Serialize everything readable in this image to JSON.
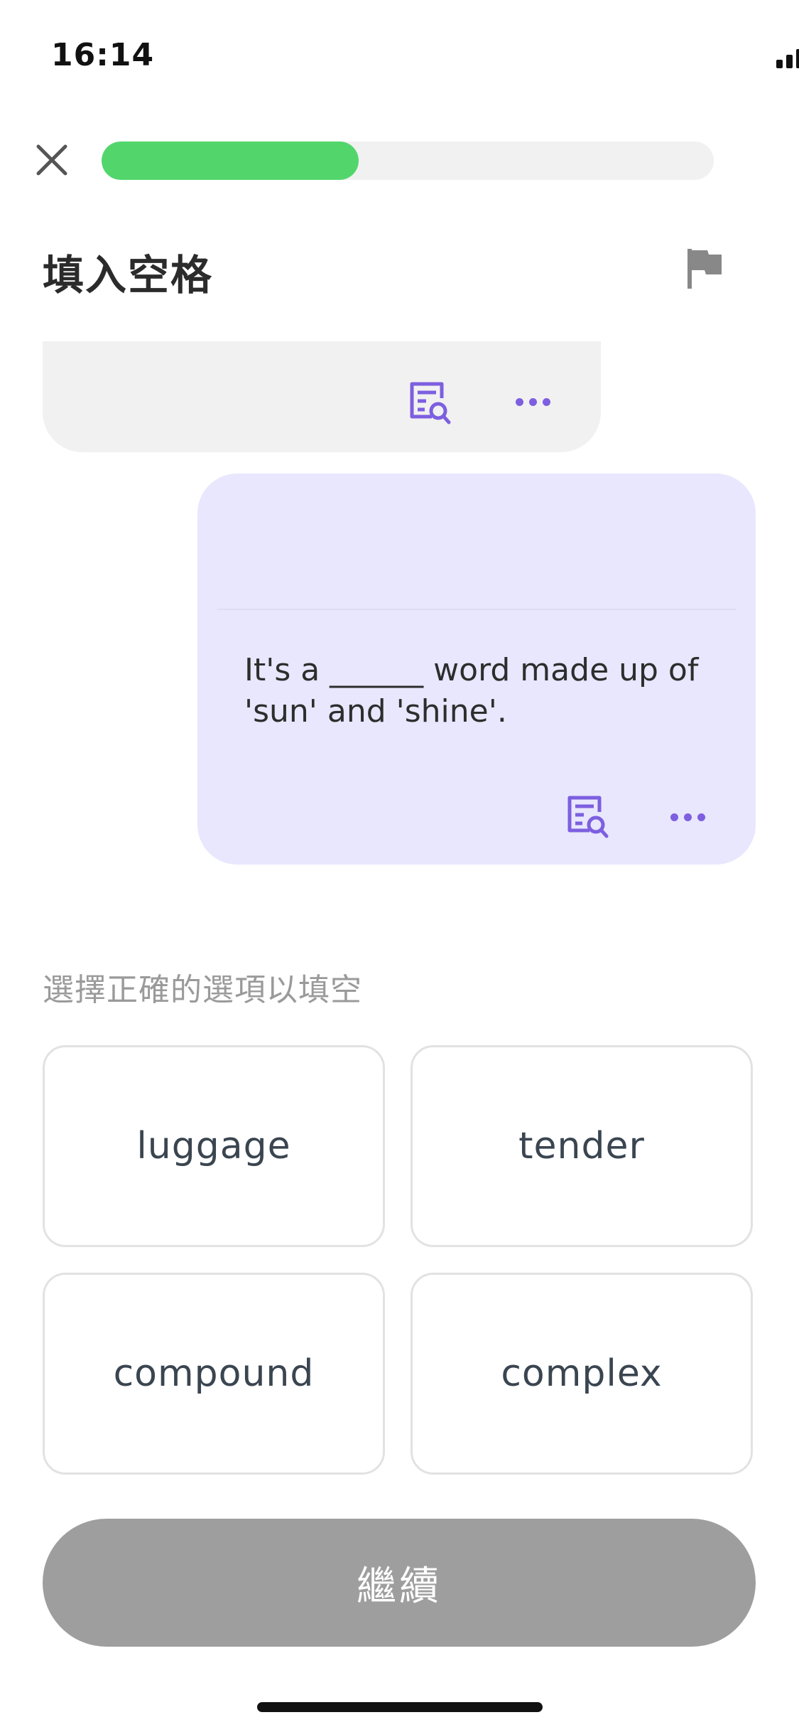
{
  "status_bar": {
    "time": "16:14",
    "battery": "100"
  },
  "progress": {
    "fraction": 0.42,
    "fill_color": "#52d66b",
    "track_color": "#f1f1f1"
  },
  "header": {
    "title": "填入空格",
    "close_icon": "close-icon",
    "flag_icon": "flag-icon"
  },
  "bubbles": {
    "top": {
      "background": "#f1f1f1",
      "icons": [
        "document-search-icon",
        "more-dots-icon"
      ]
    },
    "bottom": {
      "background": "#e8e7fd",
      "sentence": "It's a ______ word made up of 'sun' and 'shine'.",
      "icons": [
        "document-search-icon",
        "more-dots-icon"
      ]
    },
    "icon_color": "#7d5fe0"
  },
  "instruction": "選擇正確的選項以填空",
  "options": [
    {
      "label": "luggage"
    },
    {
      "label": "tender"
    },
    {
      "label": "compound"
    },
    {
      "label": "complex"
    }
  ],
  "continue_label": "繼續",
  "continue_color": "#9e9e9e"
}
